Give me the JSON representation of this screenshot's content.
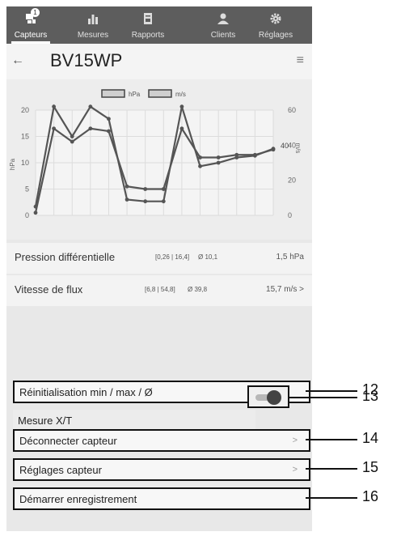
{
  "nav": {
    "items": [
      {
        "label": "Capteurs",
        "icon": "sensor-icon",
        "badge": "1",
        "active": true
      },
      {
        "label": "Mesures",
        "icon": "bar-chart-icon",
        "active": false
      },
      {
        "label": "Rapports",
        "icon": "document-icon",
        "active": false
      },
      {
        "label": "Clients",
        "icon": "person-icon",
        "active": false
      },
      {
        "label": "Réglages",
        "icon": "gear-icon",
        "active": false
      }
    ]
  },
  "header": {
    "back": "←",
    "title": "BV15WP",
    "menu": "≡"
  },
  "chart_data": {
    "type": "line",
    "legend": [
      "hPa",
      "m/s"
    ],
    "x": [
      0,
      1,
      2,
      3,
      4,
      5,
      6,
      7,
      8,
      9,
      10,
      11,
      12,
      13
    ],
    "series": [
      {
        "name": "hPa",
        "axis": "left",
        "values": [
          0.5,
          16.5,
          14,
          16.5,
          16,
          5.5,
          5,
          5,
          16.5,
          11,
          11,
          11.5,
          11.5,
          12.5
        ]
      },
      {
        "name": "m/s",
        "axis": "right",
        "values": [
          5,
          62,
          45,
          62,
          55,
          9,
          8,
          8,
          62,
          28,
          30,
          33,
          34,
          38
        ]
      }
    ],
    "left_axis": {
      "label": "hPa",
      "ticks": [
        "0",
        "5",
        "10",
        "15",
        "20"
      ],
      "range": [
        0,
        20
      ]
    },
    "right_axis": {
      "label": "m/s",
      "ticks": [
        "0",
        "20",
        "40",
        "60"
      ],
      "range": [
        0,
        60
      ]
    },
    "right_callout": "40"
  },
  "readings": [
    {
      "name": "Pression différentielle",
      "range": "[0,26 | 16,4]",
      "avg": "Ø 10,1",
      "value": "1,5 hPa"
    },
    {
      "name": "Vitesse de flux",
      "range": "[6,8 | 54,8]",
      "avg": "Ø 39,8",
      "value": "15,7 m/s >"
    }
  ],
  "options": {
    "reset": "Réinitialisation min / max / Ø",
    "xt": "Mesure X/T",
    "xt_on": true,
    "disconnect": "Déconnecter capteur",
    "settings": "Réglages capteur",
    "record": "Démarrer enregistrement",
    "chevron": ">"
  },
  "callouts": [
    "12",
    "13",
    "14",
    "15",
    "16"
  ]
}
